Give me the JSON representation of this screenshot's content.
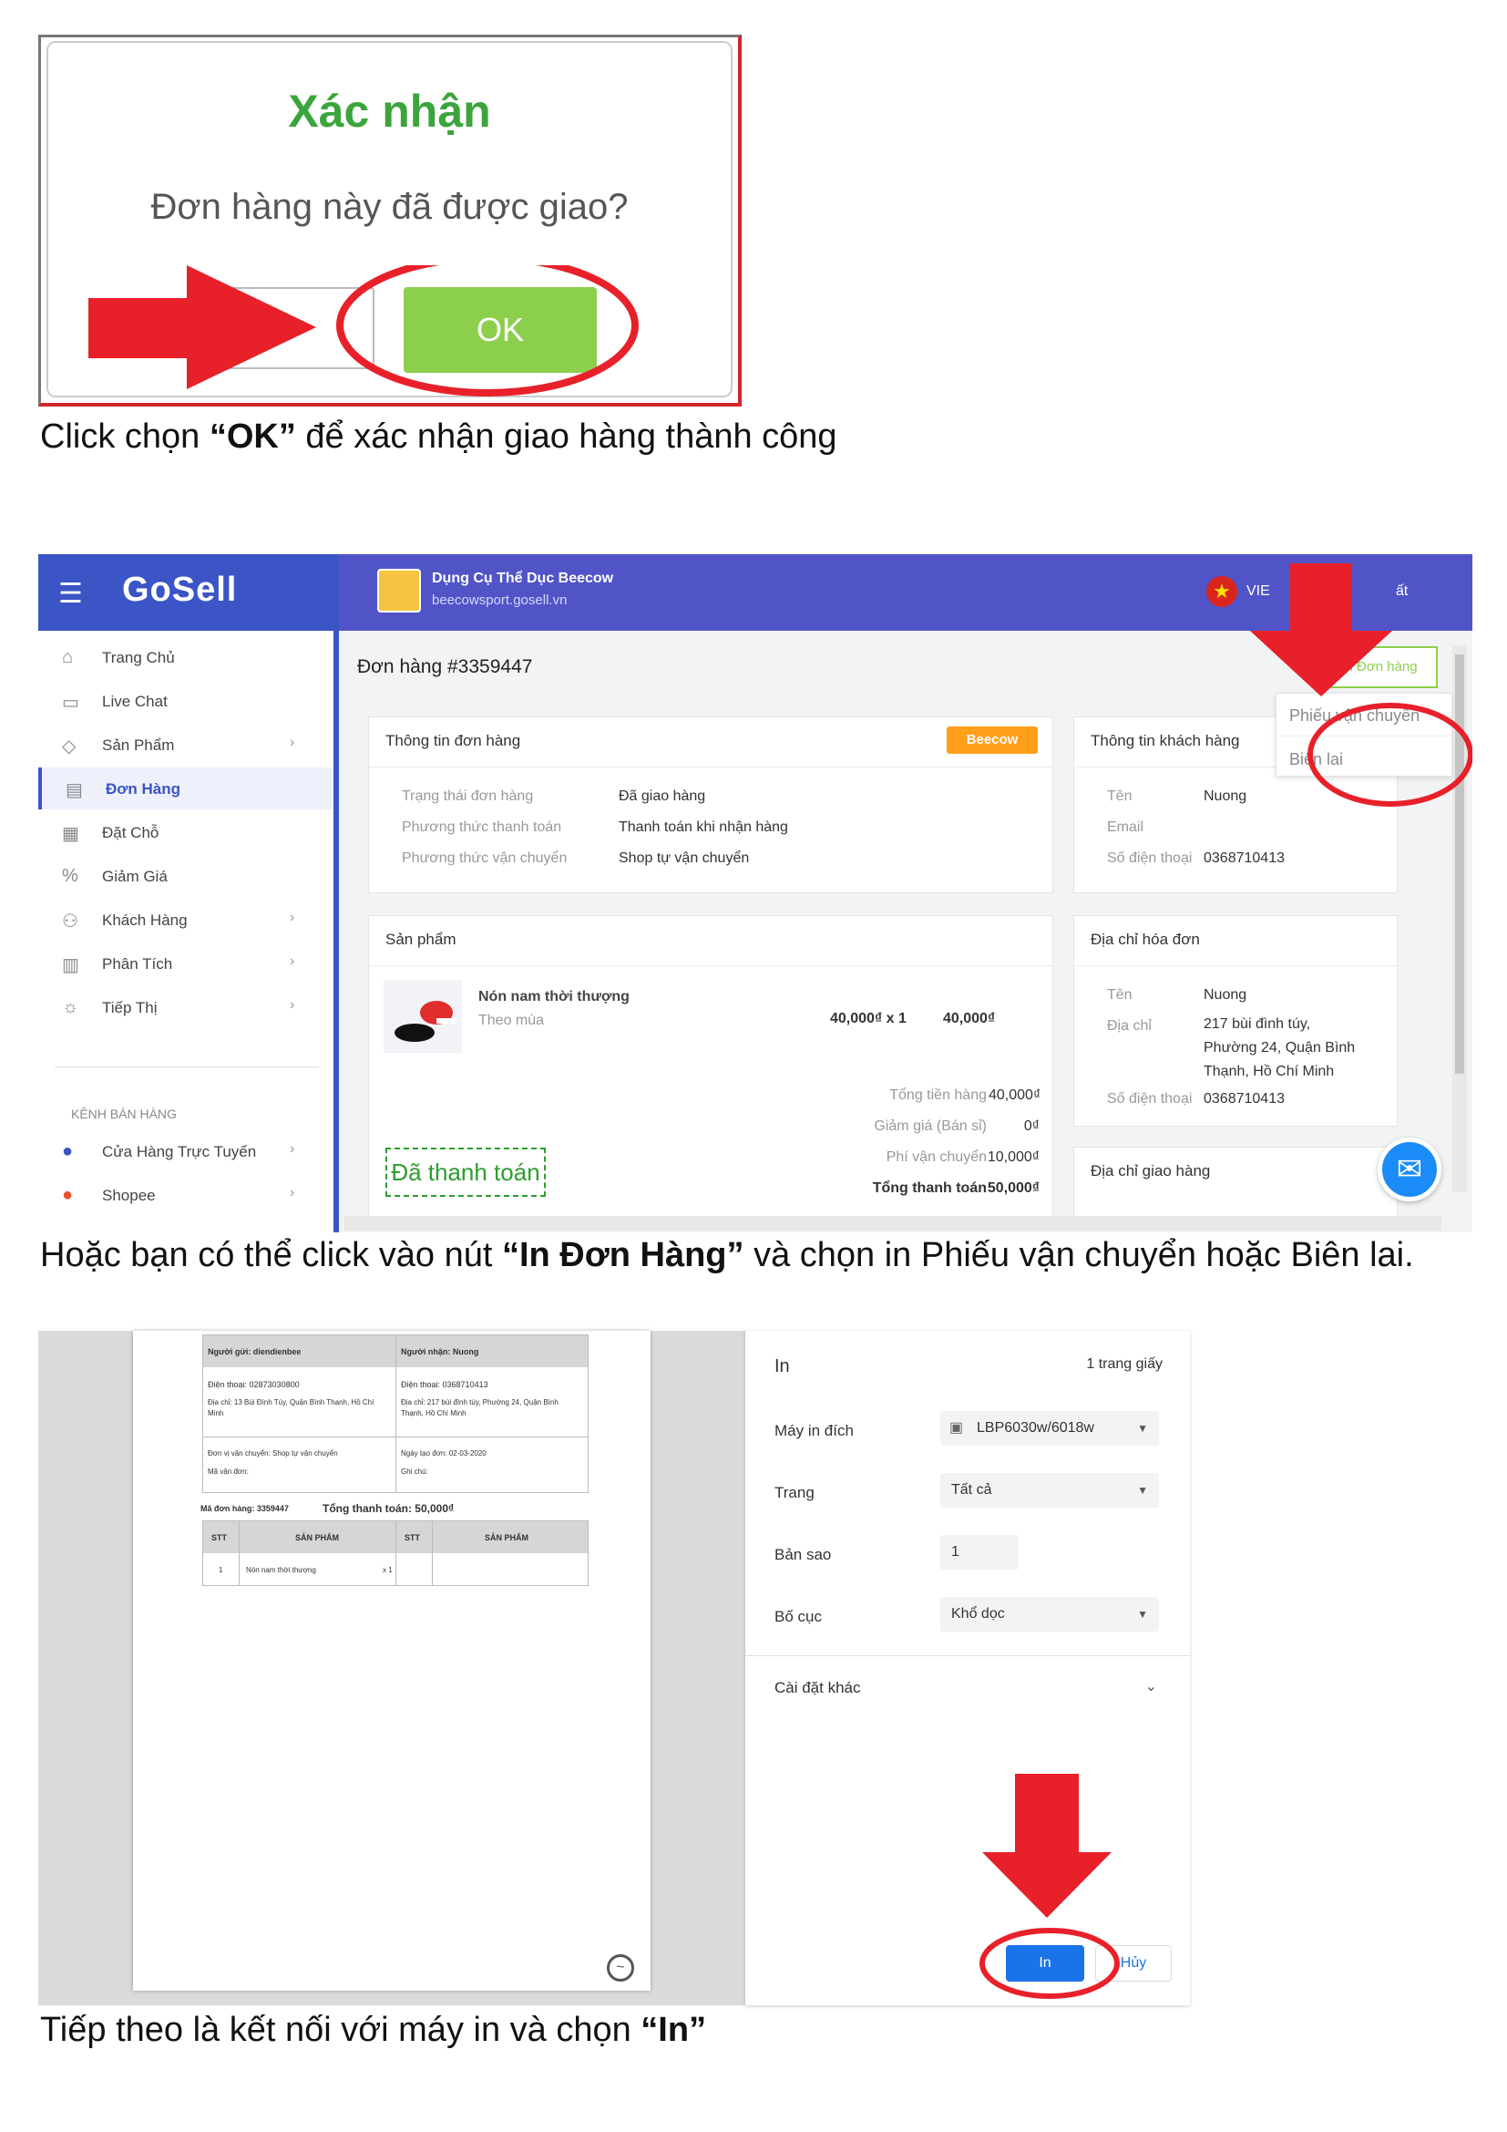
{
  "step1": {
    "dialog_title": "Xác nhận",
    "dialog_message": "Đơn hàng này đã được giao?",
    "ok_label": "OK",
    "caption_pre": "Click chọn ",
    "caption_bold": "“OK”",
    "caption_post": " để xác nhận giao hàng thành công"
  },
  "step2": {
    "logo": "GoSell",
    "shop_name": "Dụng Cụ Thể Dục Beecow",
    "shop_url": "beecowsport.gosell.vn",
    "lang": "VIE",
    "logout_label": "ất",
    "sidebar": [
      {
        "label": "Trang Chủ",
        "icon": "home-icon"
      },
      {
        "label": "Live Chat",
        "icon": "chat-icon"
      },
      {
        "label": "Sản Phẩm",
        "icon": "tag-icon"
      },
      {
        "label": "Đơn Hàng",
        "icon": "order-icon"
      },
      {
        "label": "Đặt Chỗ",
        "icon": "calendar-icon"
      },
      {
        "label": "Giảm Giá",
        "icon": "discount-icon"
      },
      {
        "label": "Khách Hàng",
        "icon": "users-icon"
      },
      {
        "label": "Phân Tích",
        "icon": "analytics-icon"
      },
      {
        "label": "Tiếp Thị",
        "icon": "marketing-icon"
      }
    ],
    "sales_channel_title": "KÊNH BÁN HÀNG",
    "channels": [
      {
        "label": "Cửa Hàng Trực Tuyến",
        "icon": "store-icon"
      },
      {
        "label": "Shopee",
        "icon": "shopee-icon"
      }
    ],
    "order_title": "Đơn hàng #3359447",
    "print_button": "In Đơn hàng",
    "print_menu": [
      "Phiếu vận chuyển",
      "Biên lai"
    ],
    "order_info": {
      "title": "Thông tin đơn hàng",
      "badge": "Beecow",
      "rows": [
        {
          "k": "Trạng thái đơn hàng",
          "v": "Đã giao hàng"
        },
        {
          "k": "Phương thức thanh toán",
          "v": "Thanh toán khi nhận hàng"
        },
        {
          "k": "Phương thức vận chuyển",
          "v": "Shop tự vận chuyển"
        }
      ]
    },
    "customer_info": {
      "title": "Thông tin khách hàng",
      "rows": [
        {
          "k": "Tên",
          "v": "Nuong"
        },
        {
          "k": "Email",
          "v": ""
        },
        {
          "k": "Số điện thoại",
          "v": "0368710413"
        }
      ]
    },
    "products": {
      "title": "Sản phẩm",
      "item_name": "Nón nam thời thượng",
      "item_variant": "Theo mùa",
      "item_qty": "40,000₫ x 1",
      "item_total": "40,000₫",
      "totals": [
        {
          "k": "Tổng tiền hàng",
          "v": "40,000₫"
        },
        {
          "k": "Giảm giá (Bán sỉ)",
          "v": "0₫"
        },
        {
          "k": "Phí vận chuyển",
          "v": "10,000₫"
        },
        {
          "k": "Tổng thanh toán",
          "v": "50,000₫"
        }
      ],
      "paid_stamp": "Đã thanh toán"
    },
    "billing": {
      "title": "Địa chỉ hóa đơn",
      "name_k": "Tên",
      "name_v": "Nuong",
      "addr_k": "Địa chỉ",
      "addr_lines": [
        "217 bùi đình túy,",
        "Phường 24, Quận Bình",
        "Thạnh, Hồ Chí Minh"
      ],
      "phone_k": "Số điện thoại",
      "phone_v": "0368710413"
    },
    "shipping_title": "Địa chỉ giao hàng",
    "caption_pre": "Hoặc bạn có thể click vào nút ",
    "caption_bold": " “In Đơn Hàng”",
    "caption_post": " và chọn in Phiếu vận chuyển hoặc Biên lai."
  },
  "step3": {
    "slip": {
      "sender": "Người gửi: diendienbee",
      "receiver": "Người nhận: Nuong",
      "sender_phone": "Điện thoại: 02873030800",
      "receiver_phone": "Điện thoại: 0368710413",
      "sender_addr_1": "Địa chỉ: 13 Bùi Đình Túy, Quận Bình Thạnh, Hồ Chí",
      "sender_addr_2": "Minh",
      "receiver_addr_1": "Địa chỉ: 217 bùi đình túy, Phường 24, Quận Bình",
      "receiver_addr_2": "Thạnh, Hồ Chí Minh",
      "carrier": "Đơn vị vận chuyển: Shop tự vận chuyển",
      "tracking": "Mã vận đơn:",
      "created": "Ngày tạo đơn: 02-03-2020",
      "note": "Ghi chú:",
      "order_no": "Mã đơn hàng: 3359447",
      "total": "Tổng thanh toán: 50,000₫",
      "col_stt": "STT",
      "col_product": "SẢN PHẨM",
      "row_no": "1",
      "row_product": "Nón nam thời thượng",
      "row_qty": "x 1"
    },
    "settings": {
      "title": "In",
      "pages": "1 trang giấy",
      "printer_k": "Máy in đích",
      "printer_v": "LBP6030w/6018w",
      "pages_k": "Trang",
      "pages_v": "Tất cả",
      "copies_k": "Bản sao",
      "copies_v": "1",
      "layout_k": "Bố cục",
      "layout_v": "Khổ dọc",
      "more": "Cài đặt khác",
      "print_btn": "In",
      "cancel_btn": "Hủy"
    },
    "caption_pre": "Tiếp theo là kết nối với máy in và chọn ",
    "caption_bold": "“In”"
  },
  "colors": {
    "annotation_red": "#e8202a",
    "gosell_blue": "#3b54c6",
    "ok_green": "#8ccf4d"
  }
}
